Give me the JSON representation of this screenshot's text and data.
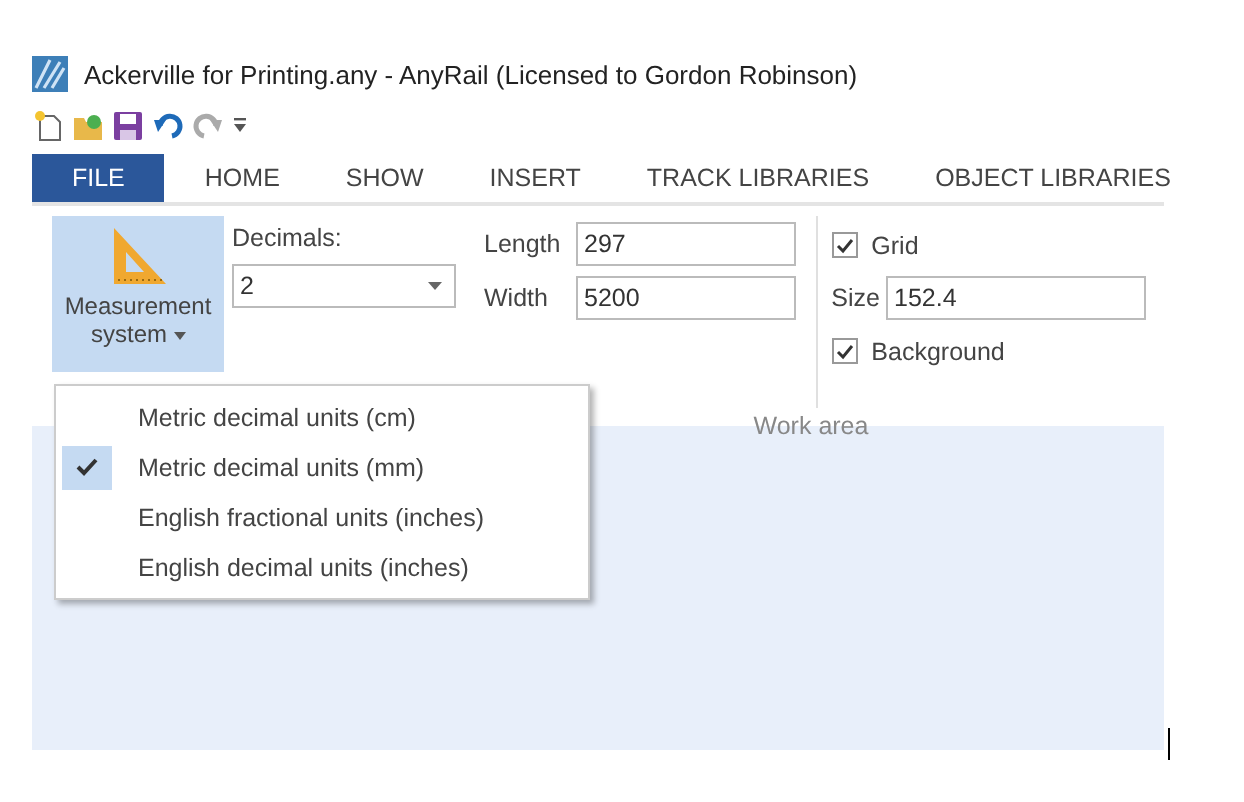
{
  "window": {
    "title": "Ackerville for Printing.any - AnyRail (Licensed to Gordon Robinson)"
  },
  "tabs": [
    {
      "label": "FILE",
      "selected": true
    },
    {
      "label": "HOME",
      "selected": false
    },
    {
      "label": "SHOW",
      "selected": false
    },
    {
      "label": "INSERT",
      "selected": false
    },
    {
      "label": "TRACK LIBRARIES",
      "selected": false
    },
    {
      "label": "OBJECT LIBRARIES",
      "selected": false
    }
  ],
  "ribbon": {
    "measurement_button": {
      "label_lines": [
        "Measurement",
        "system"
      ],
      "expanded": true
    },
    "decimals": {
      "label": "Decimals:",
      "value": "2"
    },
    "work_area": {
      "label": "Work area",
      "fields": [
        {
          "label": "Length",
          "value": "297"
        },
        {
          "label": "Width",
          "value": "5200"
        }
      ],
      "grid": {
        "label": "Grid",
        "checked": true
      },
      "size": {
        "label": "Size",
        "value": "152.4"
      },
      "background": {
        "label": "Background",
        "checked": true
      }
    }
  },
  "menu": {
    "items": [
      {
        "label": "Metric decimal units (cm)",
        "selected": false
      },
      {
        "label": "Metric decimal units (mm)",
        "selected": true
      },
      {
        "label": "English fractional units (inches)",
        "selected": false
      },
      {
        "label": "English decimal units (inches)",
        "selected": false
      }
    ]
  }
}
